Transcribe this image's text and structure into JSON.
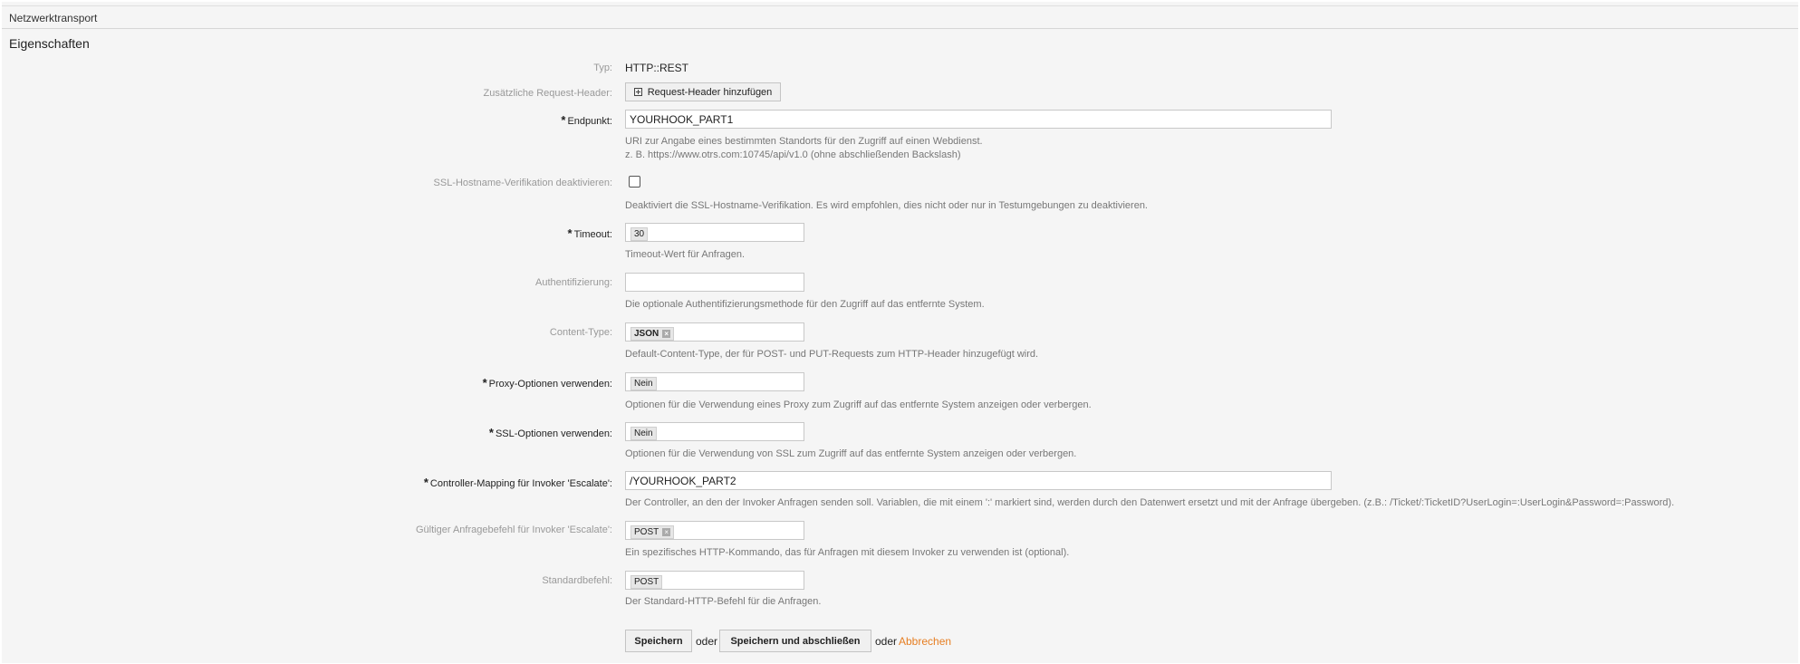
{
  "header": {
    "title": "Netzwerktransport"
  },
  "section": {
    "title": "Eigenschaften"
  },
  "fields": {
    "typ": {
      "label": "Typ:",
      "value": "HTTP::REST"
    },
    "request_header": {
      "label": "Zusätzliche Request-Header:",
      "button": "Request-Header hinzufügen"
    },
    "endpunkt": {
      "label": "Endpunkt:",
      "value": "YOURHOOK_PART1",
      "hint1": "URI zur Angabe eines bestimmten Standorts für den Zugriff auf einen Webdienst.",
      "hint2": "z. B. https://www.otrs.com:10745/api/v1.0 (ohne abschließenden Backslash)"
    },
    "ssl_hostname": {
      "label": "SSL-Hostname-Verifikation deaktivieren:",
      "checked": false,
      "hint": "Deaktiviert die SSL-Hostname-Verifikation. Es wird empfohlen, dies nicht oder nur in Testumgebungen zu deaktivieren."
    },
    "timeout": {
      "label": "Timeout:",
      "value": "30",
      "hint": "Timeout-Wert für Anfragen."
    },
    "auth": {
      "label": "Authentifizierung:",
      "value": "",
      "hint": "Die optionale Authentifizierungsmethode für den Zugriff auf das entfernte System."
    },
    "content_type": {
      "label": "Content-Type:",
      "value": "JSON",
      "hint": "Default-Content-Type, der für POST- und PUT-Requests zum HTTP-Header hinzugefügt wird."
    },
    "proxy": {
      "label": "Proxy-Optionen verwenden:",
      "value": "Nein",
      "hint": "Optionen für die Verwendung eines Proxy zum Zugriff auf das entfernte System anzeigen oder verbergen."
    },
    "ssl_options": {
      "label": "SSL-Optionen verwenden:",
      "value": "Nein",
      "hint": "Optionen für die Verwendung von SSL zum Zugriff auf das entfernte System anzeigen oder verbergen."
    },
    "controller": {
      "label": "Controller-Mapping für Invoker 'Escalate':",
      "value": "/YOURHOOK_PART2",
      "hint": "Der Controller, an den der Invoker Anfragen senden soll. Variablen, die mit einem ':' markiert sind, werden durch den Datenwert ersetzt und mit der Anfrage übergeben. (z.B.: /Ticket/:TicketID?UserLogin=:UserLogin&Password=:Password)."
    },
    "command": {
      "label": "Gültiger Anfragebefehl für Invoker 'Escalate':",
      "value": "POST",
      "hint": "Ein spezifisches HTTP-Kommando, das für Anfragen mit diesem Invoker zu verwenden ist (optional)."
    },
    "standard": {
      "label": "Standardbefehl:",
      "value": "POST",
      "hint": "Der Standard-HTTP-Befehl für die Anfragen."
    }
  },
  "actions": {
    "save": "Speichern",
    "or1": "oder",
    "save_finish": "Speichern und abschließen",
    "or2": "oder",
    "cancel": "Abbrechen"
  },
  "colors": {
    "link": "#e67e22",
    "panel": "#f5f5f5"
  }
}
